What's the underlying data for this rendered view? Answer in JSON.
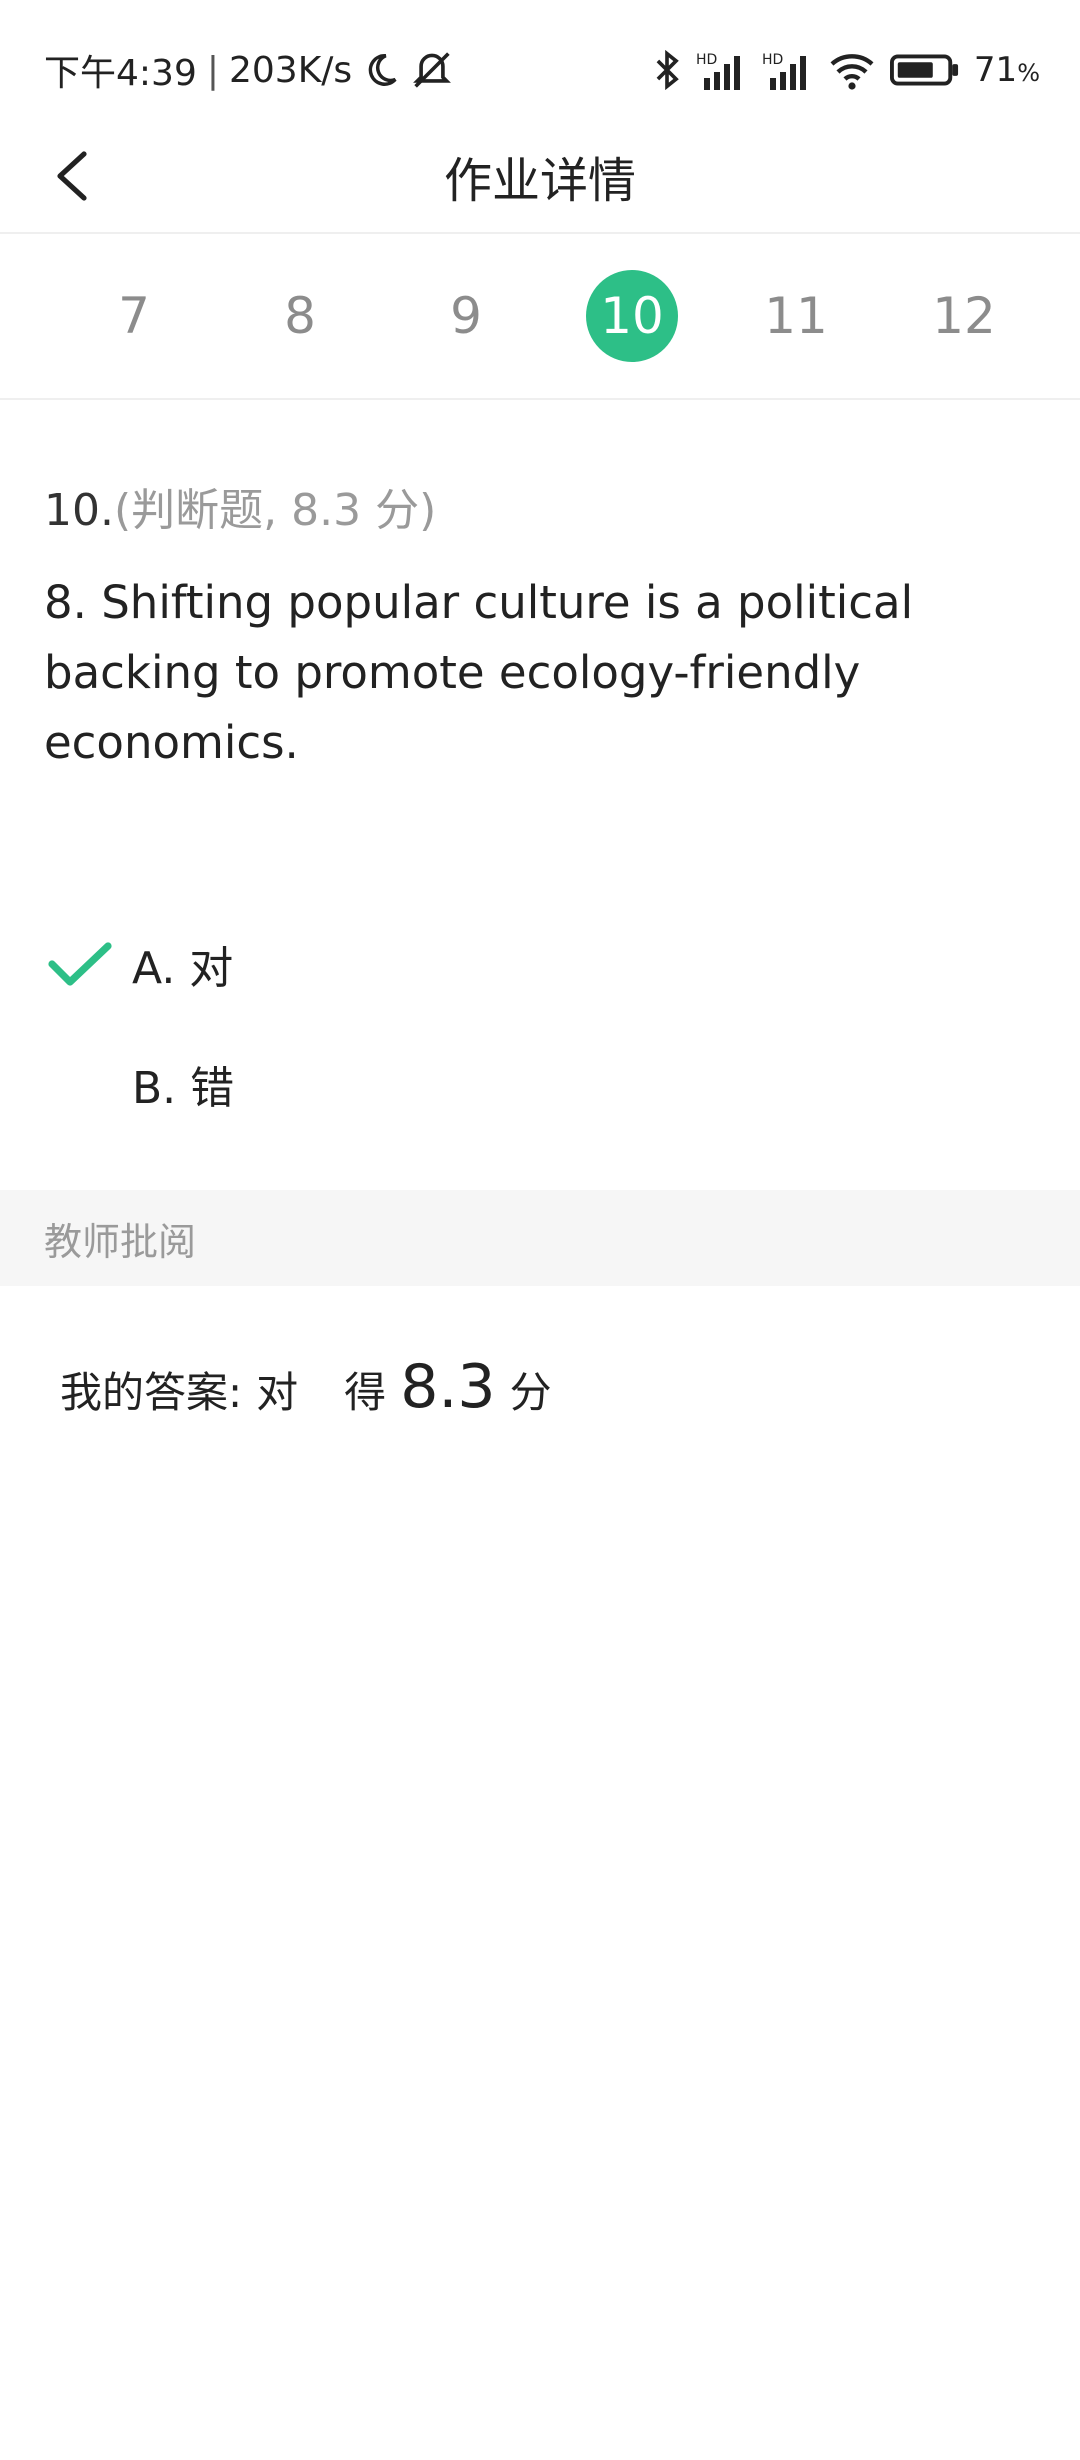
{
  "status_bar": {
    "time": "下午4:39",
    "speed": "203K/s",
    "battery_percent": "71",
    "battery_suffix": "%",
    "icons": [
      "moon-icon",
      "mute-icon",
      "bluetooth-icon",
      "signal-hd-icon",
      "signal-hd-icon",
      "wifi-icon",
      "battery-icon"
    ]
  },
  "nav": {
    "title": "作业详情"
  },
  "question_numbers": [
    "7",
    "8",
    "9",
    "10",
    "11",
    "12"
  ],
  "active_question": "10",
  "question": {
    "number": "10.",
    "meta": "(判断题,  8.3 分)",
    "text": "8. Shifting popular culture is a political backing to promote ecology-friendly economics."
  },
  "options": [
    {
      "label": "A. 对",
      "checked": true
    },
    {
      "label": "B. 错",
      "checked": false
    }
  ],
  "review": {
    "section_title": "教师批阅",
    "my_answer_label": "我的答案:",
    "my_answer": "对",
    "score_prefix": "得",
    "score": "8.3",
    "score_unit": "分"
  },
  "colors": {
    "accent": "#2dbf87"
  }
}
